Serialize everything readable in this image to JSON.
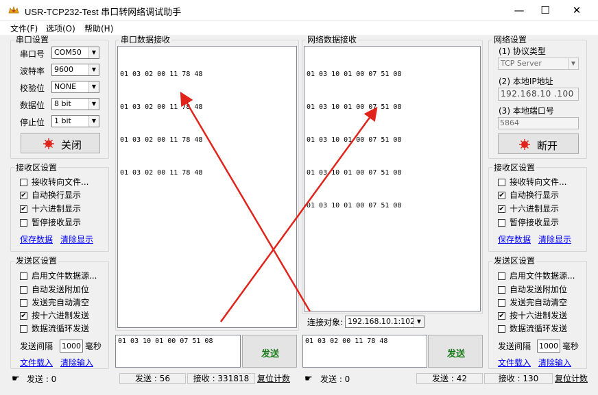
{
  "window": {
    "title": "USR-TCP232-Test 串口转网络调试助手",
    "minimize": "—",
    "maximize": "☐",
    "close": "✕"
  },
  "menu": [
    "文件(F)",
    "选项(O)",
    "帮助(H)"
  ],
  "serial_settings": {
    "title": "串口设置",
    "rows": [
      {
        "label": "串口号",
        "value": "COM50"
      },
      {
        "label": "波特率",
        "value": "9600"
      },
      {
        "label": "校验位",
        "value": "NONE"
      },
      {
        "label": "数据位",
        "value": "8 bit"
      },
      {
        "label": "停止位",
        "value": "1 bit"
      }
    ],
    "close_button": "关闭"
  },
  "left_receive": {
    "title": "接收区设置",
    "options": [
      {
        "label": "接收转向文件...",
        "checked": false
      },
      {
        "label": "自动换行显示",
        "checked": true
      },
      {
        "label": "十六进制显示",
        "checked": true
      },
      {
        "label": "暂停接收显示",
        "checked": false
      }
    ],
    "save": "保存数据",
    "clear": "清除显示"
  },
  "left_send": {
    "title": "发送区设置",
    "options": [
      {
        "label": "启用文件数据源...",
        "checked": false
      },
      {
        "label": "自动发送附加位",
        "checked": false
      },
      {
        "label": "发送完自动清空",
        "checked": false
      },
      {
        "label": "按十六进制发送",
        "checked": true
      },
      {
        "label": "数据流循环发送",
        "checked": false
      }
    ],
    "interval_label": "发送间隔",
    "interval_value": "1000",
    "interval_unit": "毫秒",
    "load": "文件载入",
    "clear": "清除输入"
  },
  "serial_rx": {
    "title": "串口数据接收",
    "lines": [
      "01 03 02 00 11 78 48",
      "01 03 02 00 11 78 48",
      "01 03 02 00 11 78 48",
      "01 03 02 00 11 78 48"
    ]
  },
  "net_rx": {
    "title": "网络数据接收",
    "lines": [
      "01 03 10 01 00 07 51 08",
      "01 03 10 01 00 07 51 08",
      "01 03 10 01 00 07 51 08",
      "01 03 10 01 00 07 51 08",
      "01 03 10 01 00 07 51 08"
    ]
  },
  "connection": {
    "label": "连接对象:",
    "value": "192.168.10.1:1028"
  },
  "serial_tx": {
    "text": "01 03 10 01 00 07 51 08",
    "send": "发送"
  },
  "net_tx": {
    "text": "01 03 02 00 11 78 48",
    "send": "发送"
  },
  "net_settings": {
    "title": "网络设置",
    "protocol_label": "(1) 协议类型",
    "protocol_value": "TCP Server",
    "ip_label": "(2) 本地IP地址",
    "ip_value": "192.168.10 .100",
    "port_label": "(3) 本地端口号",
    "port_value": "5864",
    "disconnect_button": "断开"
  },
  "right_receive": {
    "title": "接收区设置",
    "options": [
      {
        "label": "接收转向文件...",
        "checked": false
      },
      {
        "label": "自动换行显示",
        "checked": true
      },
      {
        "label": "十六进制显示",
        "checked": true
      },
      {
        "label": "暂停接收显示",
        "checked": false
      }
    ],
    "save": "保存数据",
    "clear": "清除显示"
  },
  "right_send": {
    "title": "发送区设置",
    "options": [
      {
        "label": "启用文件数据源...",
        "checked": false
      },
      {
        "label": "自动发送附加位",
        "checked": false
      },
      {
        "label": "发送完自动清空",
        "checked": false
      },
      {
        "label": "按十六进制发送",
        "checked": true
      },
      {
        "label": "数据流循环发送",
        "checked": false
      }
    ],
    "interval_label": "发送间隔",
    "interval_value": "1000",
    "interval_unit": "毫秒",
    "load": "文件载入",
    "clear": "清除输入"
  },
  "status_left": {
    "send_label": "发送 : 0",
    "sent": "发送 : 56",
    "received": "接收 : 331818",
    "reset": "复位计数"
  },
  "status_right": {
    "send_label": "发送 : 0",
    "sent": "发送 : 42",
    "received": "接收 : 130",
    "reset": "复位计数"
  },
  "colors": {
    "accent_red": "#e0241b",
    "send_text": "#1a7a1a",
    "link": "#0000ff"
  }
}
